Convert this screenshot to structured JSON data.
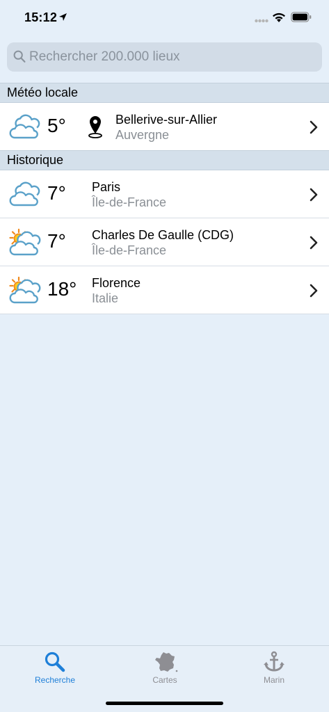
{
  "status_bar": {
    "time": "15:12"
  },
  "search": {
    "placeholder": "Rechercher 200.000 lieux",
    "value": ""
  },
  "sections": {
    "local": "Météo locale",
    "history": "Historique"
  },
  "local_item": {
    "temperature": "5°",
    "city": "Bellerive-sur-Allier",
    "region": "Auvergne",
    "weather_icon": "cloudy-icon"
  },
  "history_items": [
    {
      "temperature": "7°",
      "city": "Paris",
      "region": "Île-de-France",
      "weather_icon": "cloudy-icon"
    },
    {
      "temperature": "7°",
      "city": "Charles De Gaulle (CDG)",
      "region": "Île-de-France",
      "weather_icon": "sun-behind-cloud-icon"
    },
    {
      "temperature": "18°",
      "city": "Florence",
      "region": "Italie",
      "weather_icon": "sun-behind-cloud-icon"
    }
  ],
  "tab_bar": {
    "tabs": [
      {
        "label": "Recherche",
        "icon": "search-icon",
        "active": true
      },
      {
        "label": "Cartes",
        "icon": "france-map-icon",
        "active": false
      },
      {
        "label": "Marin",
        "icon": "anchor-icon",
        "active": false
      }
    ]
  },
  "colors": {
    "accent": "#1e7fd8",
    "background": "#e5eff9",
    "section_header": "#d4e0eb",
    "secondary_text": "#8a8f95"
  }
}
